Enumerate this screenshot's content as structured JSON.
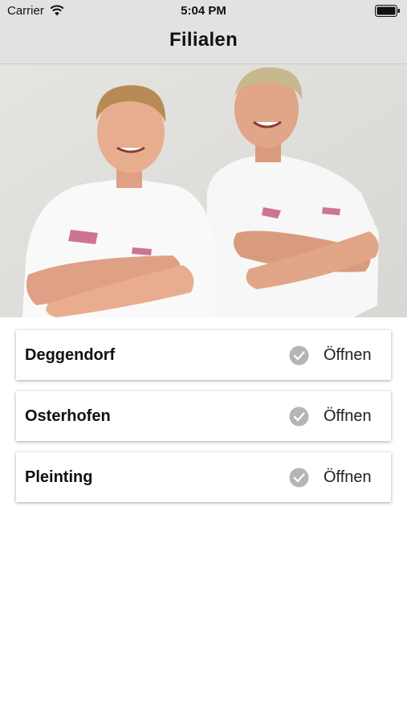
{
  "status_bar": {
    "carrier": "Carrier",
    "time": "5:04 PM",
    "wifi_icon": "wifi-icon",
    "battery_icon": "battery-icon"
  },
  "nav": {
    "title": "Filialen"
  },
  "hero": {
    "image": "photo of two smiling men in white shirts with crossed arms"
  },
  "branches": [
    {
      "name": "Deggendorf",
      "action_label": "Öffnen",
      "icon": "check-circle-icon"
    },
    {
      "name": "Osterhofen",
      "action_label": "Öffnen",
      "icon": "check-circle-icon"
    },
    {
      "name": "Pleinting",
      "action_label": "Öffnen",
      "icon": "check-circle-icon"
    }
  ],
  "colors": {
    "bar_background": "#e2e2e2",
    "check_icon": "#b5b5b5",
    "text": "#111111",
    "page_background": "#ffffff"
  }
}
